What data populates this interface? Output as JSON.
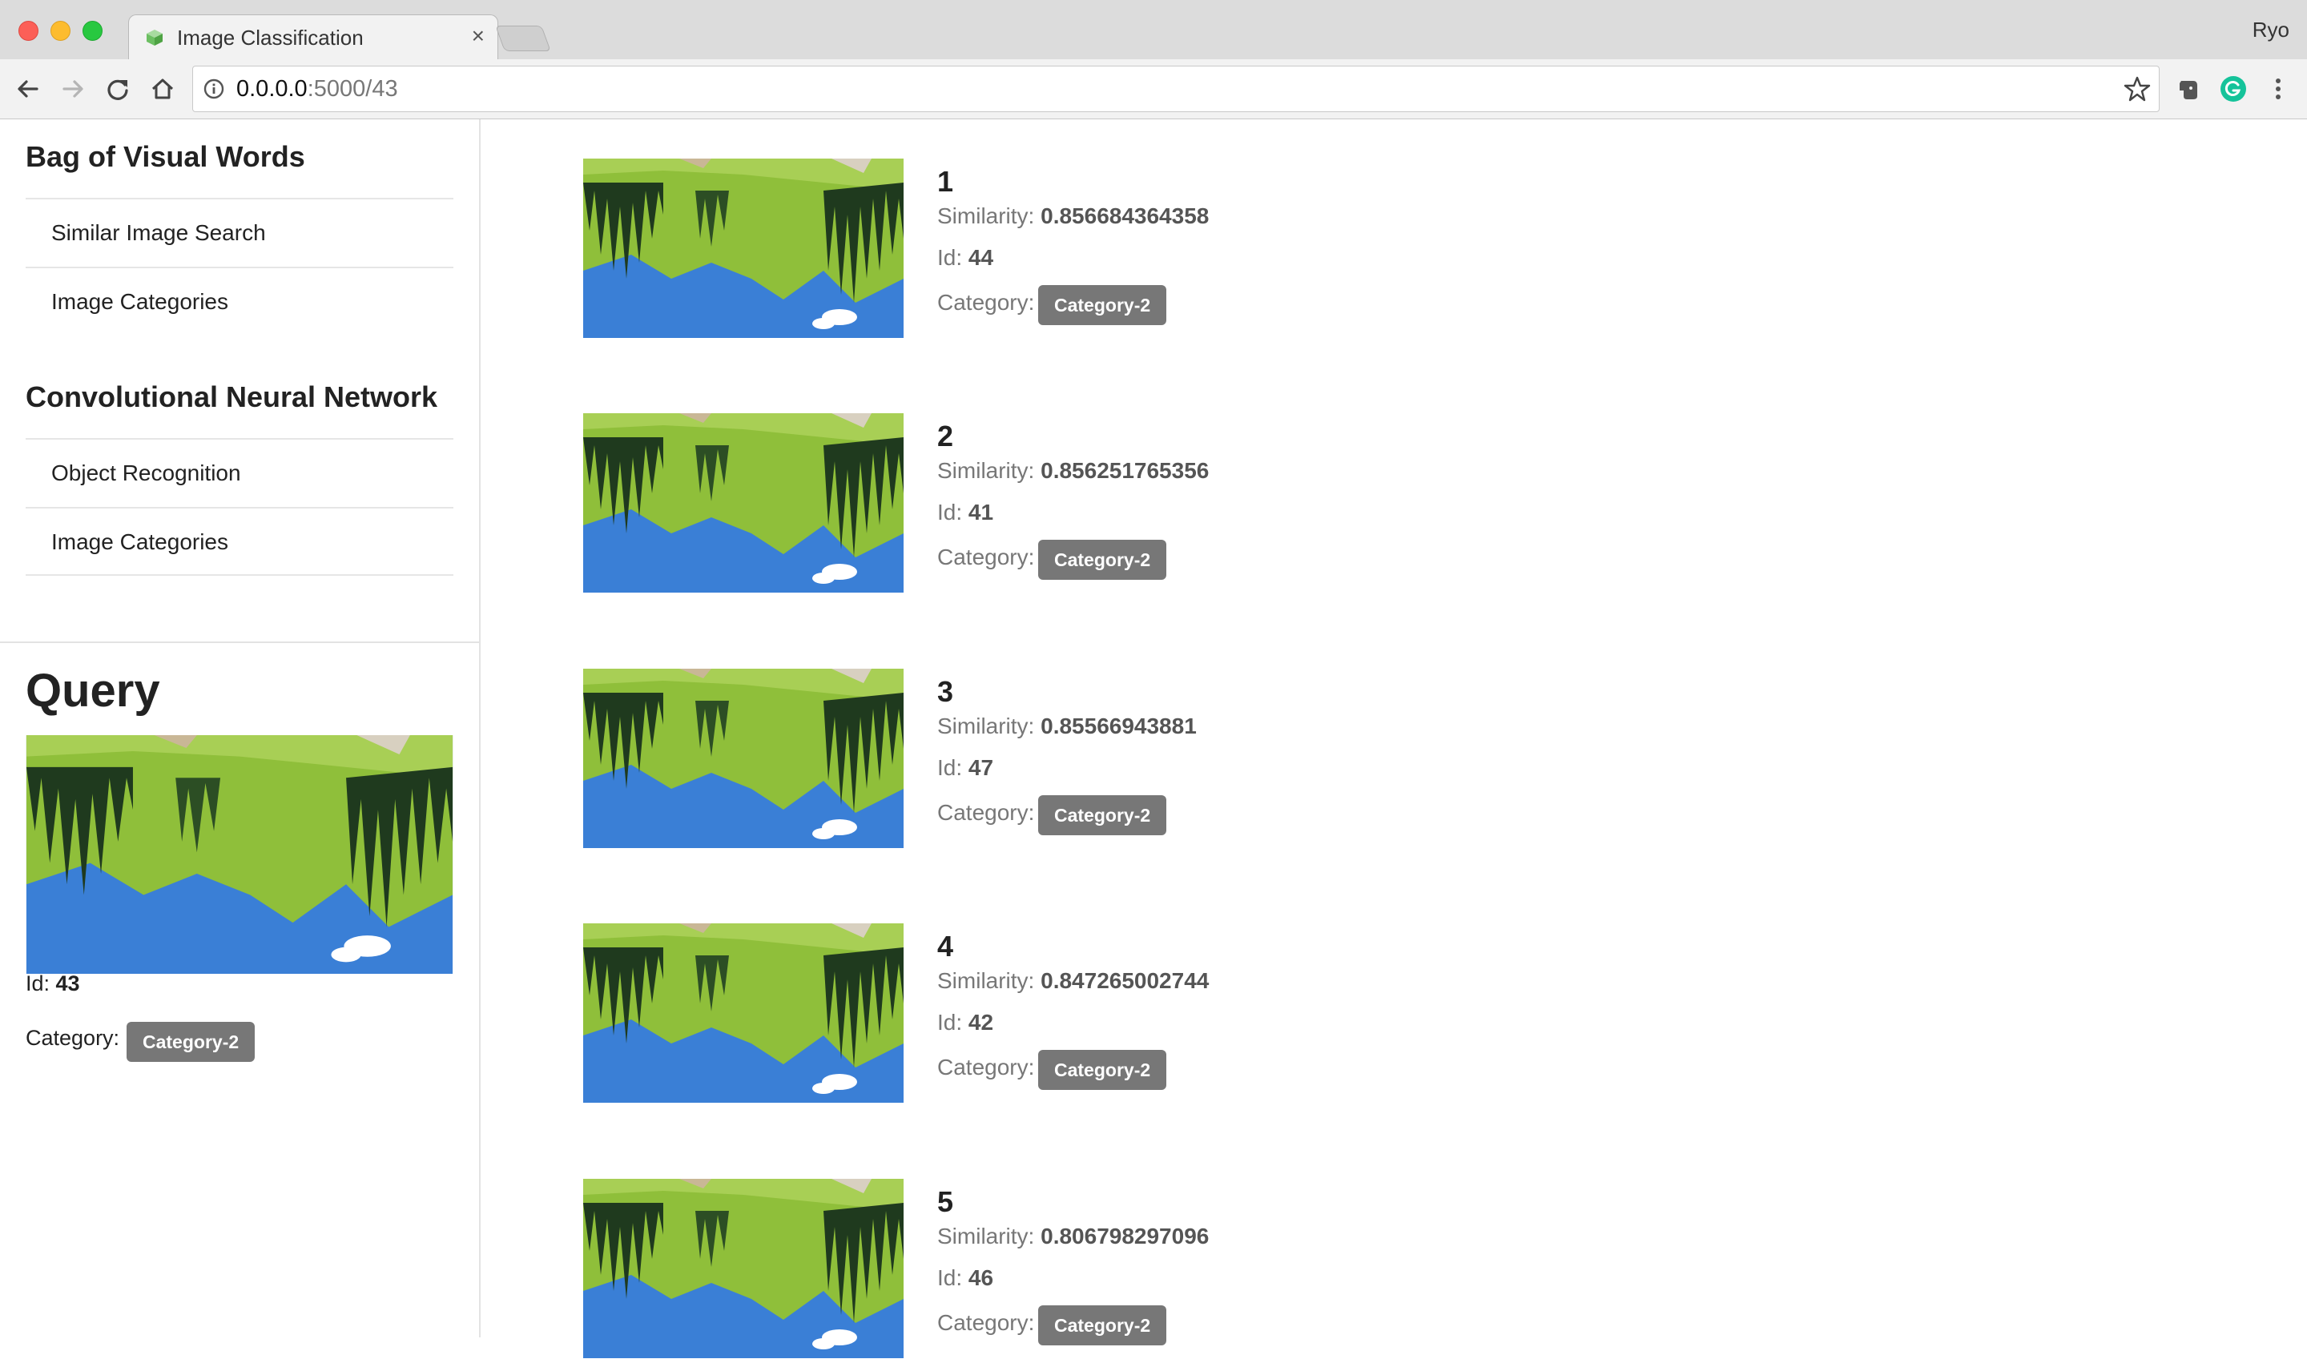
{
  "browser": {
    "tab_title": "Image Classification",
    "tab_close": "×",
    "profile_name": "Ryo",
    "url_host": "0.0.0.0",
    "url_rest": ":5000/43"
  },
  "sidebar": {
    "sections": [
      {
        "title": "Bag of Visual Words",
        "items": [
          "Similar Image Search",
          "Image Categories"
        ]
      },
      {
        "title": "Convolutional Neural Network",
        "items": [
          "Object Recognition",
          "Image Categories"
        ]
      }
    ],
    "query": {
      "title": "Query",
      "id_label": "Id: ",
      "id_value": "43",
      "category_label": "Category:",
      "category_value": "Category-2"
    }
  },
  "labels": {
    "similarity": "Similarity: ",
    "id": "Id: ",
    "category": "Category:"
  },
  "results": [
    {
      "rank": "1",
      "similarity": "0.856684364358",
      "id": "44",
      "category": "Category-2"
    },
    {
      "rank": "2",
      "similarity": "0.856251765356",
      "id": "41",
      "category": "Category-2"
    },
    {
      "rank": "3",
      "similarity": "0.85566943881",
      "id": "47",
      "category": "Category-2"
    },
    {
      "rank": "4",
      "similarity": "0.847265002744",
      "id": "42",
      "category": "Category-2"
    },
    {
      "rank": "5",
      "similarity": "0.806798297096",
      "id": "46",
      "category": "Category-2"
    }
  ],
  "colors": {
    "badge": "#777777",
    "muted_text": "#777777",
    "sky": "#3a7fd6",
    "grass": "#8fbf3a",
    "trees": "#1f3a1e"
  }
}
